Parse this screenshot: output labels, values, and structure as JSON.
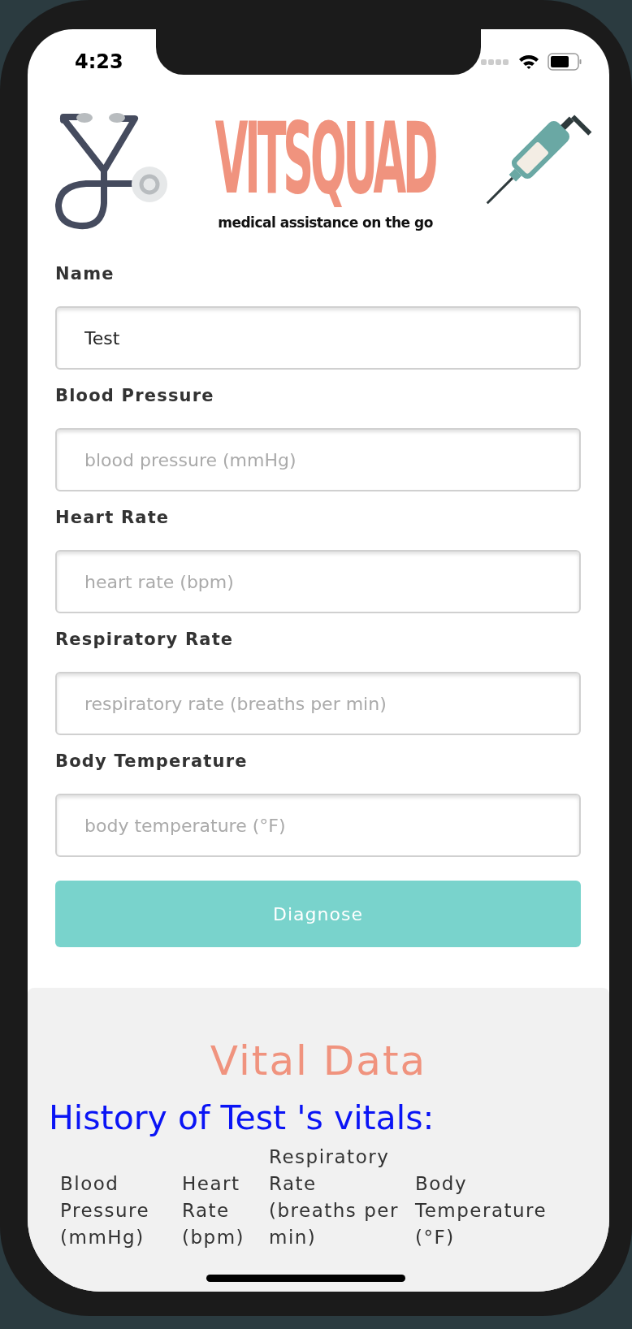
{
  "status_bar": {
    "time": "4:23"
  },
  "header": {
    "logo": "VITSQUAD",
    "tagline": "medical assistance on the go"
  },
  "fields": [
    {
      "label": "Name",
      "value": "Test"
    },
    {
      "label": "Blood Pressure",
      "placeholder": "blood pressure (mmHg)"
    },
    {
      "label": "Heart Rate",
      "placeholder": "heart rate (bpm)"
    },
    {
      "label": "Respiratory Rate",
      "placeholder": "respiratory rate (breaths per min)"
    },
    {
      "label": "Body Temperature",
      "placeholder": "body temperature (°F)"
    }
  ],
  "diagnose_button": "Diagnose",
  "vital_data": {
    "title": "Vital Data",
    "history_title": "History of Test 's vitals:",
    "table": {
      "columns": [
        "Blood Pressure (mmHg)",
        "Heart Rate (bpm)",
        "Respiratory Rate (breaths per min)",
        "Body Temperature (°F)"
      ]
    }
  }
}
